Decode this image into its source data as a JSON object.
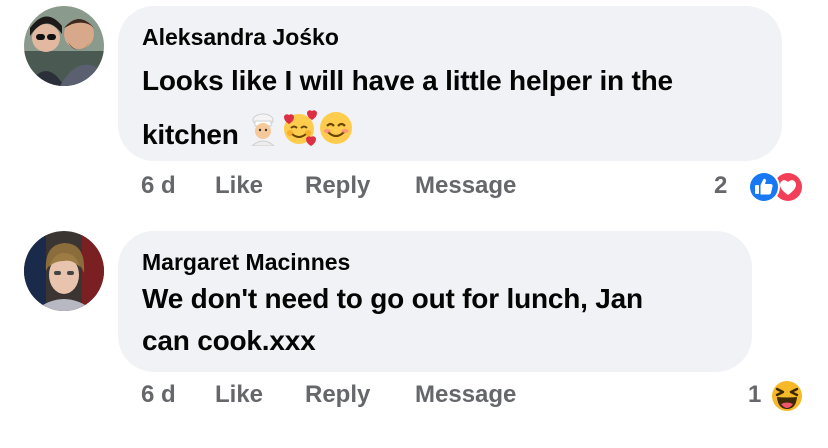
{
  "comments": [
    {
      "author": "Aleksandra Jośko",
      "text_line1": "Looks like I will have a little helper in the",
      "text_line2": "kitchen",
      "emojis": [
        "cook-emoji",
        "smiling-face-with-hearts-emoji",
        "smiling-face-with-smiling-eyes-emoji"
      ],
      "time": "6 d",
      "like_label": "Like",
      "reply_label": "Reply",
      "message_label": "Message",
      "reaction_count": "2",
      "reactions": [
        "like-reaction-icon",
        "love-reaction-icon"
      ]
    },
    {
      "author": "Margaret Macinnes",
      "text_line1": "We don't need to go out for lunch, Jan",
      "text_line2": "can cook.xxx",
      "time": "6 d",
      "like_label": "Like",
      "reply_label": "Reply",
      "message_label": "Message",
      "reaction_count": "1",
      "reactions": [
        "haha-reaction-icon"
      ]
    }
  ],
  "colors": {
    "bubble": "#f0f2f5",
    "text": "#050505",
    "meta": "#65676b",
    "like_blue": "#1877f2",
    "love_red": "#f33e58",
    "haha_yellow": "#f7b928"
  }
}
